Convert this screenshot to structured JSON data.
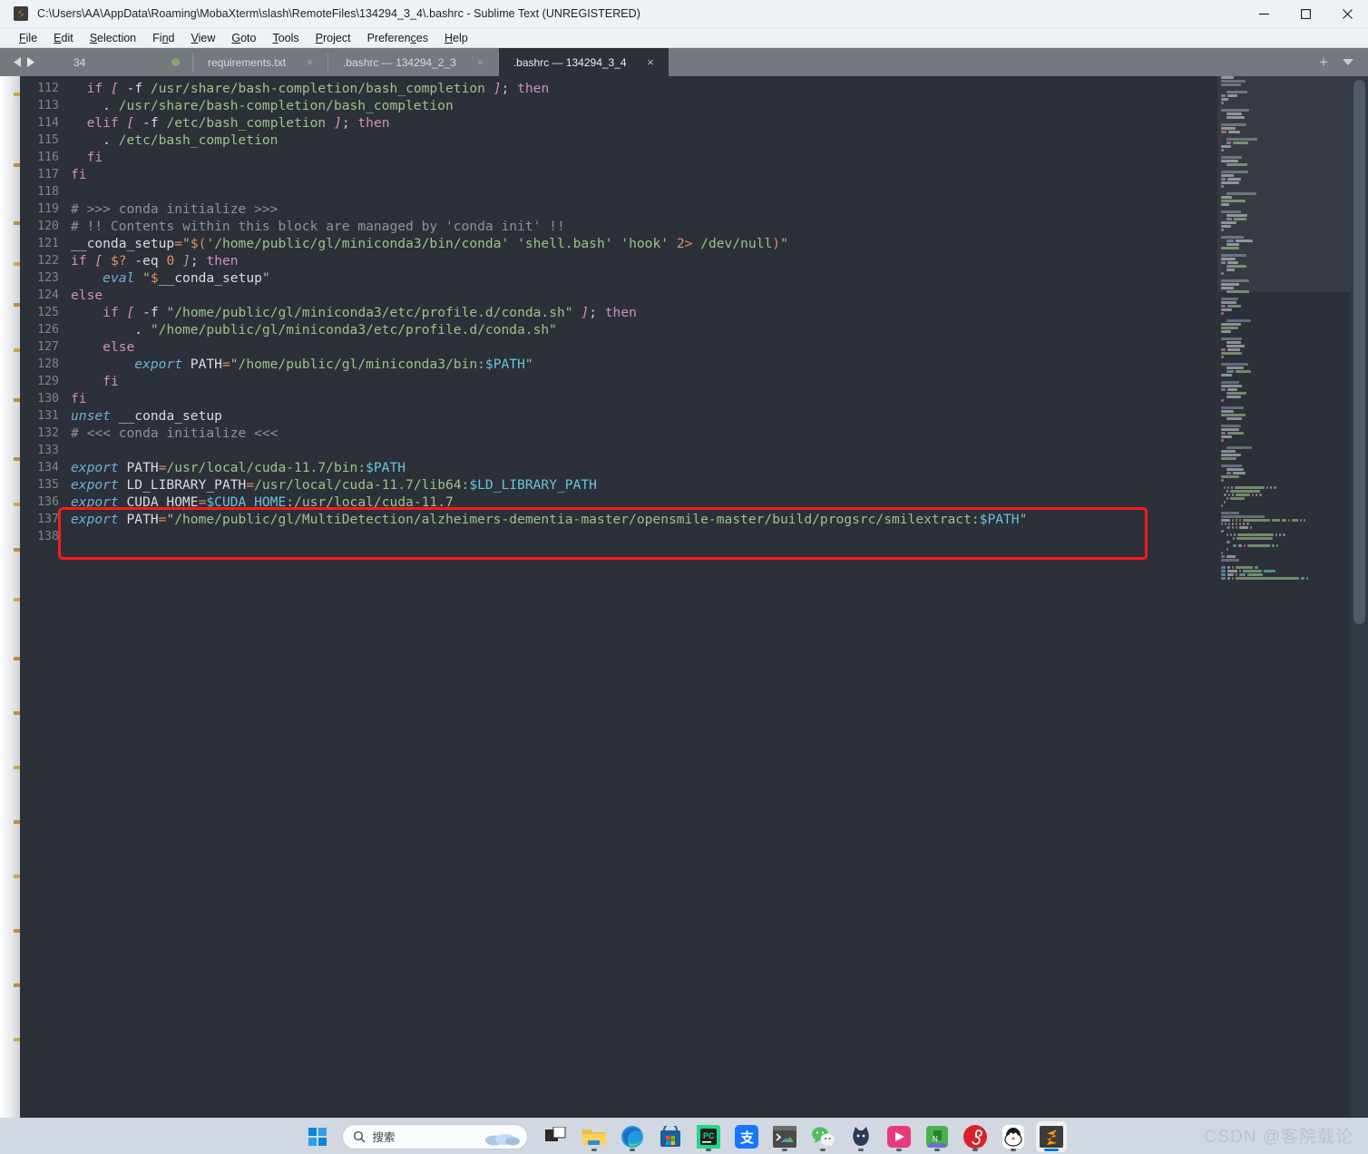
{
  "window": {
    "title": "C:\\Users\\AA\\AppData\\Roaming\\MobaXterm\\slash\\RemoteFiles\\134294_3_4\\.bashrc - Sublime Text (UNREGISTERED)",
    "logo_name": "sublime-text-logo",
    "controls": {
      "minimize": "Minimize",
      "maximize": "Maximize",
      "close": "Close"
    }
  },
  "menubar": {
    "items": [
      {
        "label": "File",
        "accel": "F"
      },
      {
        "label": "Edit",
        "accel": "E"
      },
      {
        "label": "Selection",
        "accel": "S"
      },
      {
        "label": "Find",
        "accel": "n"
      },
      {
        "label": "View",
        "accel": "V"
      },
      {
        "label": "Goto",
        "accel": "G"
      },
      {
        "label": "Tools",
        "accel": "T"
      },
      {
        "label": "Project",
        "accel": "P"
      },
      {
        "label": "Preferences",
        "accel": "c"
      },
      {
        "label": "Help",
        "accel": "H"
      }
    ]
  },
  "tabbar": {
    "nav_number": "34",
    "tabs": [
      {
        "label": "requirements.txt",
        "active": false,
        "close": "×"
      },
      {
        "label": ".bashrc — 134294_2_3",
        "active": false,
        "close": "×"
      },
      {
        "label": ".bashrc — 134294_3_4",
        "active": true,
        "close": "×"
      }
    ],
    "new_tab_label": "+",
    "tab_menu_label": "tab-list-dropdown"
  },
  "editor": {
    "first_line_number": 112,
    "lines": [
      {
        "n": 112,
        "tokens": [
          {
            "t": "  ",
            "c": "plain"
          },
          {
            "t": "if",
            "c": "kw"
          },
          {
            "t": " ",
            "c": "plain"
          },
          {
            "t": "[",
            "c": "brk"
          },
          {
            "t": " -f ",
            "c": "plain"
          },
          {
            "t": "/usr/share/bash-completion/bash_completion",
            "c": "str"
          },
          {
            "t": " ",
            "c": "plain"
          },
          {
            "t": "]",
            "c": "brk"
          },
          {
            "t": "; ",
            "c": "punc"
          },
          {
            "t": "then",
            "c": "kw"
          }
        ]
      },
      {
        "n": 113,
        "tokens": [
          {
            "t": "    . ",
            "c": "plain"
          },
          {
            "t": "/usr/share/bash-completion/bash_completion",
            "c": "str"
          }
        ]
      },
      {
        "n": 114,
        "tokens": [
          {
            "t": "  ",
            "c": "plain"
          },
          {
            "t": "elif",
            "c": "kw"
          },
          {
            "t": " ",
            "c": "plain"
          },
          {
            "t": "[",
            "c": "brk"
          },
          {
            "t": " -f ",
            "c": "plain"
          },
          {
            "t": "/etc/bash_completion",
            "c": "str"
          },
          {
            "t": " ",
            "c": "plain"
          },
          {
            "t": "]",
            "c": "brk"
          },
          {
            "t": "; ",
            "c": "punc"
          },
          {
            "t": "then",
            "c": "kw"
          }
        ]
      },
      {
        "n": 115,
        "tokens": [
          {
            "t": "    . ",
            "c": "plain"
          },
          {
            "t": "/etc/bash_completion",
            "c": "str"
          }
        ]
      },
      {
        "n": 116,
        "tokens": [
          {
            "t": "  ",
            "c": "plain"
          },
          {
            "t": "fi",
            "c": "kw"
          }
        ]
      },
      {
        "n": 117,
        "tokens": [
          {
            "t": "fi",
            "c": "kw"
          }
        ]
      },
      {
        "n": 118,
        "tokens": []
      },
      {
        "n": 119,
        "tokens": [
          {
            "t": "# >>> conda initialize >>>",
            "c": "cmt"
          }
        ]
      },
      {
        "n": 120,
        "tokens": [
          {
            "t": "# !! Contents within this block are managed by 'conda init' !!",
            "c": "cmt"
          }
        ]
      },
      {
        "n": 121,
        "tokens": [
          {
            "t": "__conda_setup",
            "c": "plain"
          },
          {
            "t": "=",
            "c": "op"
          },
          {
            "t": "\"",
            "c": "str"
          },
          {
            "t": "$(",
            "c": "op"
          },
          {
            "t": "'/home/public/gl/miniconda3/bin/conda'",
            "c": "str"
          },
          {
            "t": " ",
            "c": "plain"
          },
          {
            "t": "'shell.bash'",
            "c": "str"
          },
          {
            "t": " ",
            "c": "plain"
          },
          {
            "t": "'hook'",
            "c": "str"
          },
          {
            "t": " ",
            "c": "plain"
          },
          {
            "t": "2>",
            "c": "op"
          },
          {
            "t": " /dev/null",
            "c": "str"
          },
          {
            "t": ")",
            "c": "op"
          },
          {
            "t": "\"",
            "c": "str"
          }
        ]
      },
      {
        "n": 122,
        "tokens": [
          {
            "t": "if",
            "c": "kw"
          },
          {
            "t": " ",
            "c": "plain"
          },
          {
            "t": "[",
            "c": "brk"
          },
          {
            "t": " ",
            "c": "plain"
          },
          {
            "t": "$?",
            "c": "op"
          },
          {
            "t": " -eq ",
            "c": "plain"
          },
          {
            "t": "0",
            "c": "num"
          },
          {
            "t": " ",
            "c": "plain"
          },
          {
            "t": "]",
            "c": "brk"
          },
          {
            "t": "; ",
            "c": "punc"
          },
          {
            "t": "then",
            "c": "kw"
          }
        ]
      },
      {
        "n": 123,
        "tokens": [
          {
            "t": "    ",
            "c": "plain"
          },
          {
            "t": "eval",
            "c": "fn"
          },
          {
            "t": " ",
            "c": "plain"
          },
          {
            "t": "\"",
            "c": "str"
          },
          {
            "t": "$",
            "c": "op"
          },
          {
            "t": "__conda_setup",
            "c": "plain"
          },
          {
            "t": "\"",
            "c": "str"
          }
        ]
      },
      {
        "n": 124,
        "tokens": [
          {
            "t": "else",
            "c": "kw"
          }
        ]
      },
      {
        "n": 125,
        "tokens": [
          {
            "t": "    ",
            "c": "plain"
          },
          {
            "t": "if",
            "c": "kw"
          },
          {
            "t": " ",
            "c": "plain"
          },
          {
            "t": "[",
            "c": "brk"
          },
          {
            "t": " -f ",
            "c": "plain"
          },
          {
            "t": "\"/home/public/gl/miniconda3/etc/profile.d/conda.sh\"",
            "c": "str"
          },
          {
            "t": " ",
            "c": "plain"
          },
          {
            "t": "]",
            "c": "brk"
          },
          {
            "t": "; ",
            "c": "punc"
          },
          {
            "t": "then",
            "c": "kw"
          }
        ]
      },
      {
        "n": 126,
        "tokens": [
          {
            "t": "        . ",
            "c": "plain"
          },
          {
            "t": "\"/home/public/gl/miniconda3/etc/profile.d/conda.sh\"",
            "c": "str"
          }
        ]
      },
      {
        "n": 127,
        "tokens": [
          {
            "t": "    ",
            "c": "plain"
          },
          {
            "t": "else",
            "c": "kw"
          }
        ]
      },
      {
        "n": 128,
        "tokens": [
          {
            "t": "        ",
            "c": "plain"
          },
          {
            "t": "export",
            "c": "fn"
          },
          {
            "t": " PATH",
            "c": "plain"
          },
          {
            "t": "=",
            "c": "op"
          },
          {
            "t": "\"/home/public/gl/miniconda3/bin:",
            "c": "str"
          },
          {
            "t": "$PATH",
            "c": "var"
          },
          {
            "t": "\"",
            "c": "str"
          }
        ]
      },
      {
        "n": 129,
        "tokens": [
          {
            "t": "    ",
            "c": "plain"
          },
          {
            "t": "fi",
            "c": "kw"
          }
        ]
      },
      {
        "n": 130,
        "tokens": [
          {
            "t": "fi",
            "c": "kw"
          }
        ]
      },
      {
        "n": 131,
        "tokens": [
          {
            "t": "unset",
            "c": "fn"
          },
          {
            "t": " __conda_setup",
            "c": "plain"
          }
        ]
      },
      {
        "n": 132,
        "tokens": [
          {
            "t": "# <<< conda initialize <<<",
            "c": "cmt"
          }
        ]
      },
      {
        "n": 133,
        "tokens": []
      },
      {
        "n": 134,
        "tokens": [
          {
            "t": "export",
            "c": "fn"
          },
          {
            "t": " PATH",
            "c": "plain"
          },
          {
            "t": "=",
            "c": "op"
          },
          {
            "t": "/usr/local/cuda-11.7/bin:",
            "c": "str"
          },
          {
            "t": "$PATH",
            "c": "var"
          }
        ]
      },
      {
        "n": 135,
        "tokens": [
          {
            "t": "export",
            "c": "fn"
          },
          {
            "t": " LD_LIBRARY_PATH",
            "c": "plain"
          },
          {
            "t": "=",
            "c": "op"
          },
          {
            "t": "/usr/local/cuda-11.7/lib64:",
            "c": "str"
          },
          {
            "t": "$LD_LIBRARY_PATH",
            "c": "var"
          }
        ]
      },
      {
        "n": 136,
        "tokens": [
          {
            "t": "export",
            "c": "fn"
          },
          {
            "t": " CUDA_HOME",
            "c": "plain"
          },
          {
            "t": "=",
            "c": "op"
          },
          {
            "t": "$CUDA_HOME",
            "c": "var"
          },
          {
            "t": ":/usr/local/cuda-11.7",
            "c": "str"
          }
        ]
      },
      {
        "n": 137,
        "tokens": [
          {
            "t": "export",
            "c": "fn"
          },
          {
            "t": " PATH",
            "c": "plain"
          },
          {
            "t": "=",
            "c": "op"
          },
          {
            "t": "\"/home/public/gl/MultiDetection/alzheimers-dementia-master/opensmile-master/build/progsrc/smilextract:",
            "c": "str"
          },
          {
            "t": "$PATH",
            "c": "var"
          },
          {
            "t": "\"",
            "c": "str"
          }
        ]
      },
      {
        "n": 138,
        "tokens": []
      }
    ],
    "annotation": {
      "name": "red-highlight-box",
      "color": "#ff1a1a"
    },
    "colors": {
      "background": "#2b3039",
      "gutter_text": "#7f848e",
      "keyword": "#d58fbb",
      "function": "#6fb3d2",
      "string": "#9fc28a",
      "comment": "#8c939f",
      "variable": "#69c5d6",
      "operator": "#e08f6a",
      "plain": "#d9dde3"
    }
  },
  "taskbar": {
    "start_label": "start-button",
    "search": {
      "placeholder": "搜索",
      "value": ""
    },
    "icons": [
      {
        "name": "task-view-icon",
        "running": false
      },
      {
        "name": "file-explorer-icon",
        "running": true
      },
      {
        "name": "microsoft-edge-icon",
        "running": true
      },
      {
        "name": "microsoft-store-icon",
        "running": false
      },
      {
        "name": "pycharm-icon",
        "running": true
      },
      {
        "name": "alipay-icon",
        "running": false
      },
      {
        "name": "terminal-icon",
        "running": true
      },
      {
        "name": "wechat-icon",
        "running": true
      },
      {
        "name": "tim-cat-icon",
        "running": true
      },
      {
        "name": "bilibili-icon",
        "running": true
      },
      {
        "name": "evernote-icon",
        "running": true
      },
      {
        "name": "netease-music-icon",
        "running": true
      },
      {
        "name": "qq-icon",
        "running": true
      },
      {
        "name": "sublime-text-icon",
        "running": true,
        "active": true
      }
    ],
    "watermark": "CSDN @客院载论"
  }
}
